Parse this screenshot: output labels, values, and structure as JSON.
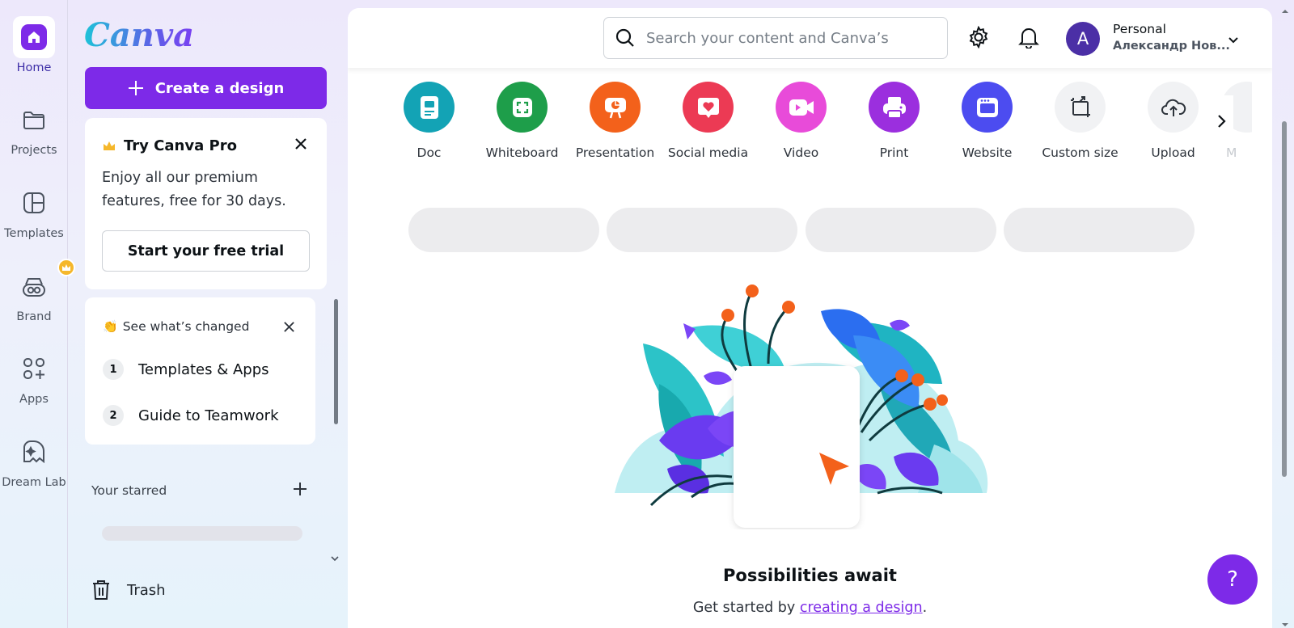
{
  "rail": {
    "items": [
      {
        "label": "Home",
        "icon": "home-icon"
      },
      {
        "label": "Projects",
        "icon": "folder-icon"
      },
      {
        "label": "Templates",
        "icon": "templates-icon"
      },
      {
        "label": "Brand",
        "icon": "brand-icon"
      },
      {
        "label": "Apps",
        "icon": "apps-icon"
      },
      {
        "label": "Dream Lab",
        "icon": "dream-lab-icon"
      }
    ],
    "active": "Home"
  },
  "sidebar": {
    "logo": "Canva",
    "create_label": "Create a design",
    "pro": {
      "title": "Try Canva Pro",
      "description": "Enjoy all our premium features, free for 30 days.",
      "trial_label": "Start your free trial"
    },
    "changed": {
      "title": "See what’s changed",
      "items": [
        {
          "num": "1",
          "label": "Templates & Apps"
        },
        {
          "num": "2",
          "label": "Guide to Teamwork"
        }
      ]
    },
    "starred_label": "Your starred",
    "trash_label": "Trash"
  },
  "topbar": {
    "search_placeholder": "Search your content and Canva’s",
    "account_type": "Personal",
    "account_user": "Александр Нов...",
    "avatar_letter": "A"
  },
  "design_types": [
    {
      "label": "Doc",
      "color": "#13a3b5",
      "icon": "doc-icon"
    },
    {
      "label": "Whiteboard",
      "color": "#1e9e4a",
      "icon": "whiteboard-icon"
    },
    {
      "label": "Presentation",
      "color": "#f3611b",
      "icon": "presentation-icon"
    },
    {
      "label": "Social media",
      "color": "#ec3a54",
      "icon": "heart-icon"
    },
    {
      "label": "Video",
      "color": "#e84bd9",
      "icon": "video-icon"
    },
    {
      "label": "Print",
      "color": "#9b2fde",
      "icon": "print-icon"
    },
    {
      "label": "Website",
      "color": "#4c4cf0",
      "icon": "website-icon"
    },
    {
      "label": "Custom size",
      "color": "#f1f2f4",
      "icon": "custom-size-icon"
    },
    {
      "label": "Upload",
      "color": "#f1f2f4",
      "icon": "upload-icon"
    },
    {
      "label": "M",
      "color": "#f1f2f4",
      "icon": "more-icon"
    }
  ],
  "empty_state": {
    "title": "Possibilities await",
    "sub_prefix": "Get started by ",
    "sub_link": "creating a design",
    "sub_suffix": "."
  },
  "help_label": "?",
  "colors": {
    "brand": "#7d2ae8",
    "avatar": "#4b2fa6"
  }
}
